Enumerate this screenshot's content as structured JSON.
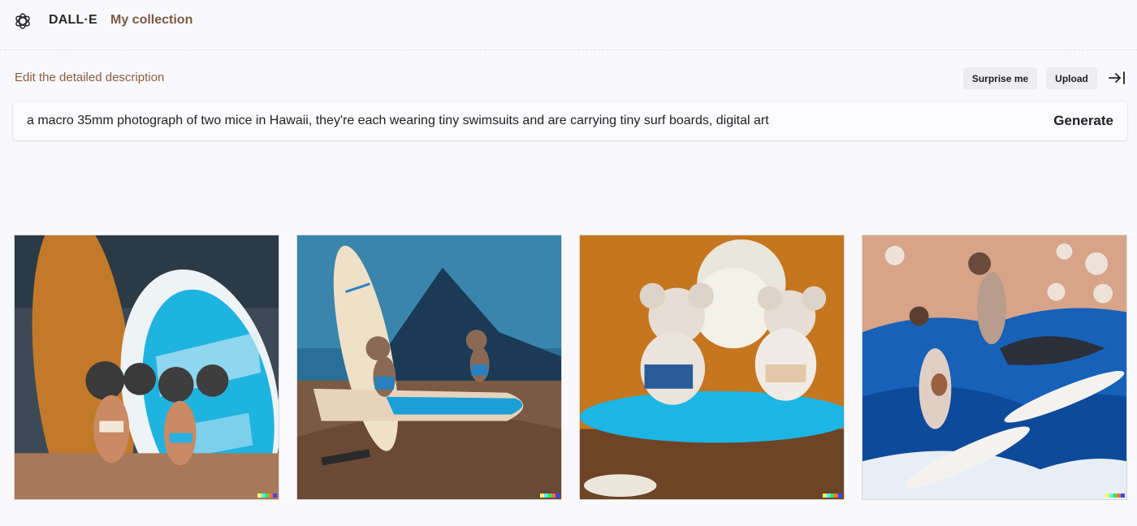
{
  "header": {
    "brand": "DALL·E",
    "nav_collection": "My collection",
    "logo_icon": "openai-logo-icon"
  },
  "prompt": {
    "edit_label": "Edit the detailed description",
    "surprise_label": "Surprise me",
    "upload_label": "Upload",
    "collapse_icon": "arrow-right-to-bar-icon",
    "value": "a macro 35mm photograph of two mice in Hawaii, they're each wearing tiny swimsuits and are carrying tiny surf boards, digital art",
    "generate_label": "Generate"
  },
  "images": [
    {
      "subject": "two mice in swimsuits standing in front of surfboards"
    },
    {
      "subject": "two mice on a surfboard on a beach with mountains"
    },
    {
      "subject": "two white mice in shorts on a blue surfboard"
    },
    {
      "subject": "two tall mice surfing on waves"
    }
  ],
  "colors": {
    "background": "#f9f9fb",
    "accent_brown": "#8a5c3e",
    "pill_bg": "#ececf1"
  }
}
